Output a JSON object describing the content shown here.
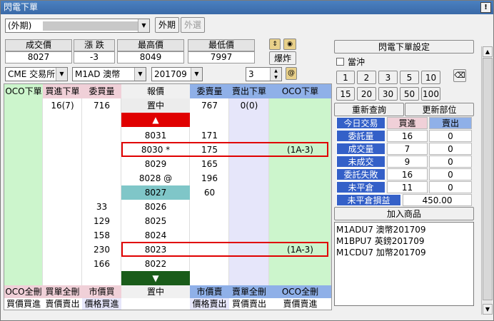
{
  "window": {
    "title": "閃電下單"
  },
  "top": {
    "account_combo": "(外期)",
    "tab_foreign": "外期",
    "tab_external": "外選"
  },
  "stats": {
    "headers": [
      "成交價",
      "漲 跌",
      "最高價",
      "最低價"
    ],
    "values": [
      "8027",
      "-3",
      "8049",
      "7997"
    ]
  },
  "burst_button": "爆炸",
  "selectors": {
    "exchange": "CME 交易所",
    "product": "M1AD  澳幣",
    "month": "201709",
    "qty": "3"
  },
  "ladder": {
    "headers": [
      "OCO下單",
      "買進下單",
      "委買量",
      "報價",
      "委賣量",
      "賣出下單",
      "OCO下單"
    ],
    "top_row": {
      "buy_order": "16(7)",
      "bid_qty": "716",
      "price": "置中",
      "ask_qty": "767",
      "sell_order": "0(0)"
    },
    "up_label": "▲",
    "down_label": "▼",
    "rows": [
      {
        "price": "8031",
        "bid": "",
        "ask": "171",
        "oco": "",
        "highlight": false,
        "type": "ask"
      },
      {
        "price": "8030 *",
        "bid": "",
        "ask": "175",
        "oco": "(1A-3)",
        "highlight": true,
        "type": "ask"
      },
      {
        "price": "8029",
        "bid": "",
        "ask": "165",
        "oco": "",
        "highlight": false,
        "type": "ask"
      },
      {
        "price": "8028 @",
        "bid": "",
        "ask": "196",
        "oco": "",
        "highlight": false,
        "type": "ask"
      },
      {
        "price": "8027",
        "bid": "",
        "ask": "60",
        "oco": "",
        "highlight": false,
        "type": "last"
      },
      {
        "price": "8026",
        "bid": "33",
        "ask": "",
        "oco": "",
        "highlight": false,
        "type": "bid"
      },
      {
        "price": "8025",
        "bid": "129",
        "ask": "",
        "oco": "",
        "highlight": false,
        "type": "bid"
      },
      {
        "price": "8024",
        "bid": "158",
        "ask": "",
        "oco": "",
        "highlight": false,
        "type": "bid"
      },
      {
        "price": "8023",
        "bid": "230",
        "ask": "",
        "oco": "(1A-3)",
        "highlight": true,
        "type": "bid"
      },
      {
        "price": "8022",
        "bid": "166",
        "ask": "",
        "oco": "",
        "highlight": false,
        "type": "bid"
      }
    ],
    "footer1": [
      "OCO全刪",
      "買單全刪",
      "市價買",
      "置中",
      "市價賣",
      "賣單全刪",
      "OCO全刪"
    ],
    "footer2": [
      "買價買進",
      "賣價賣出",
      "價格買進",
      "",
      "價格賣出",
      "買價賣出",
      "賣價賣進"
    ]
  },
  "right": {
    "settings_button": "閃電下單設定",
    "day_trade_label": "當沖",
    "qty_buttons_row1": [
      "1",
      "2",
      "3",
      "5",
      "10"
    ],
    "qty_buttons_row2": [
      "15",
      "20",
      "30",
      "50",
      "100"
    ],
    "requery_button": "重新查詢",
    "update_position_button": "更新部位",
    "summary_header": [
      "今日交易",
      "買進",
      "賣出"
    ],
    "summary_rows": [
      {
        "label": "委託量",
        "buy": "16",
        "sell": "0"
      },
      {
        "label": "成交量",
        "buy": "7",
        "sell": "0"
      },
      {
        "label": "未成交",
        "buy": "9",
        "sell": "0"
      },
      {
        "label": "委託失敗",
        "buy": "16",
        "sell": "0"
      },
      {
        "label": "未平倉",
        "buy": "11",
        "sell": "0"
      }
    ],
    "unrealized_label": "未平倉損益",
    "unrealized_value": "450.00",
    "add_product_button": "加入商品",
    "products": [
      "M1ADU7 澳幣201709",
      "M1BPU7 英鎊201709",
      "M1CDU7 加幣201709"
    ]
  },
  "colors": {
    "green_col": "#ccf5cc",
    "blue_header": "#8fb0e8",
    "pink_header": "#f0d0d8",
    "lavender_col": "#e6e6fa",
    "up_red": "#e00000",
    "down_green": "#1a5c1a",
    "last_teal": "#7fc6c8"
  }
}
